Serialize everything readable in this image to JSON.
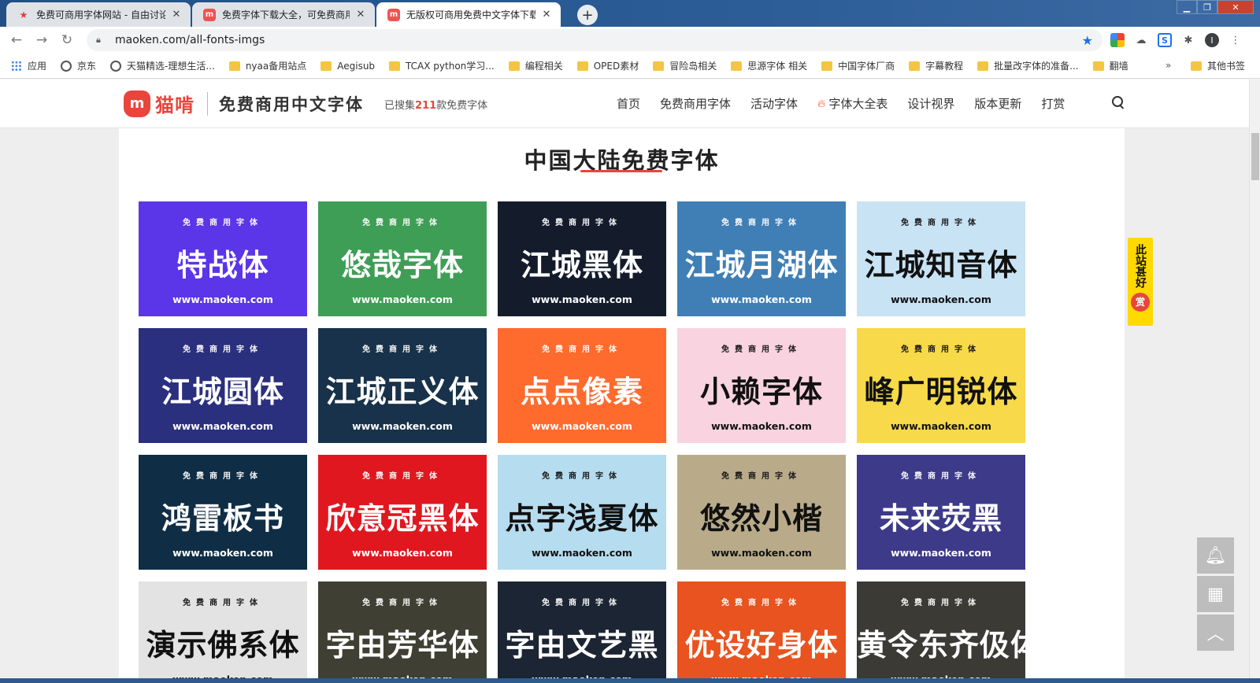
{
  "browser": {
    "tabs": [
      {
        "title": "免费可商用字体网站 - 自由讨论",
        "icon": "star-favicon",
        "active": false
      },
      {
        "title": "免费字体下载大全，可免费商用",
        "icon": "cat-favicon",
        "active": false
      },
      {
        "title": "无版权可商用免费中文字体下载",
        "icon": "cat-favicon",
        "active": true
      }
    ],
    "close_glyph": "✕",
    "new_tab_glyph": "+",
    "window_controls": {
      "minimize": "▁",
      "maximize": "❐",
      "close": "✕"
    },
    "url": "maoken.com/all-fonts-imgs",
    "profile_initial": "I",
    "bookmarks": [
      {
        "label": "应用",
        "icon": "apps"
      },
      {
        "label": "京东",
        "icon": "globe"
      },
      {
        "label": "天猫精选-理想生活...",
        "icon": "globe"
      },
      {
        "label": "nyaa备用站点",
        "icon": "folder"
      },
      {
        "label": "Aegisub",
        "icon": "folder"
      },
      {
        "label": "TCAX python学习...",
        "icon": "folder"
      },
      {
        "label": "编程相关",
        "icon": "folder"
      },
      {
        "label": "OPED素材",
        "icon": "folder"
      },
      {
        "label": "冒险岛相关",
        "icon": "folder"
      },
      {
        "label": "思源字体 相关",
        "icon": "folder"
      },
      {
        "label": "中国字体厂商",
        "icon": "folder"
      },
      {
        "label": "字幕教程",
        "icon": "folder"
      },
      {
        "label": "批量改字体的准备...",
        "icon": "folder"
      },
      {
        "label": "翻墙",
        "icon": "folder"
      }
    ],
    "bookmarks_more": "»",
    "other_bookmarks": "其他书签"
  },
  "site": {
    "logo_mark": "m",
    "logo_name": "猫啃",
    "slogan": "免费商用中文字体",
    "collected_prefix": "已搜集",
    "collected_count": "211",
    "collected_suffix": "款免费字体",
    "nav": [
      "首页",
      "免费商用字体",
      "活动字体",
      "字体大全表",
      "设计视界",
      "版本更新",
      "打赏"
    ],
    "section_title": "中国大陆免费字体",
    "card_tag": "免费商用字体",
    "card_url": "www.maoken.com",
    "fonts": [
      {
        "name": "特战体",
        "bg": "#5b35e8"
      },
      {
        "name": "悠哉字体",
        "bg": "#3e9e55"
      },
      {
        "name": "江城黑体",
        "bg": "#141c2c"
      },
      {
        "name": "江城月湖体",
        "bg": "#3f7fb5"
      },
      {
        "name": "江城知音体",
        "bg": "#c8e3f4"
      },
      {
        "name": "江城圆体",
        "bg": "#2a2f7e"
      },
      {
        "name": "江城正义体",
        "bg": "#17324a"
      },
      {
        "name": "点点像素",
        "bg": "#ff6a2d"
      },
      {
        "name": "小赖字体",
        "bg": "#fad3e0"
      },
      {
        "name": "峰广明锐体",
        "bg": "#f7d94a"
      },
      {
        "name": "鸿雷板书",
        "bg": "#0f2d45"
      },
      {
        "name": "欣意冠黑体",
        "bg": "#e0171f"
      },
      {
        "name": "点字浅夏体",
        "bg": "#b6dcef"
      },
      {
        "name": "悠然小楷",
        "bg": "#b9ab8a"
      },
      {
        "name": "未来荧黑",
        "bg": "#3d3a8a"
      },
      {
        "name": "演示佛系体",
        "bg": "#e3e3e3"
      },
      {
        "name": "字由芳华体",
        "bg": "#3f4033"
      },
      {
        "name": "字由文艺黑",
        "bg": "#1c2533"
      },
      {
        "name": "优设好身体",
        "bg": "#e8531f"
      },
      {
        "name": "黄令东齐伋体",
        "bg": "#3b3a35"
      }
    ],
    "reward_label": "此站甚好",
    "reward_coin": "赏"
  }
}
